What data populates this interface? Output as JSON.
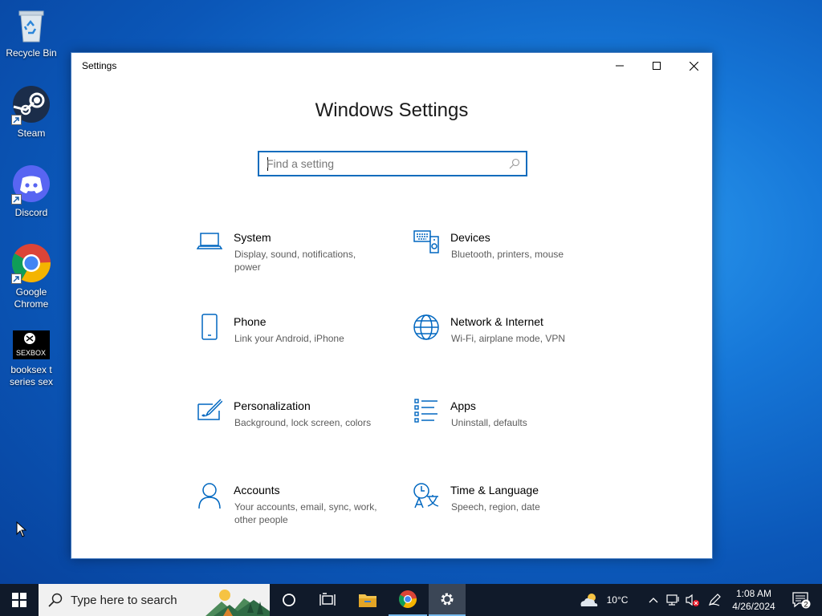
{
  "desktop": {
    "icons": [
      {
        "label": "Recycle Bin"
      },
      {
        "label": "Steam"
      },
      {
        "label": "Discord"
      },
      {
        "label": "Google Chrome"
      },
      {
        "label": "booksex t series sex",
        "thumb_text": "SEXBOX"
      }
    ]
  },
  "window": {
    "title": "Settings",
    "heading": "Windows Settings",
    "search": {
      "placeholder": "Find a setting",
      "value": ""
    },
    "tiles": [
      {
        "name": "System",
        "desc": "Display, sound, notifications, power",
        "icon": "laptop-icon"
      },
      {
        "name": "Devices",
        "desc": "Bluetooth, printers, mouse",
        "icon": "keyboard-speaker-icon"
      },
      {
        "name": "Phone",
        "desc": "Link your Android, iPhone",
        "icon": "phone-icon"
      },
      {
        "name": "Network & Internet",
        "desc": "Wi-Fi, airplane mode, VPN",
        "icon": "globe-icon"
      },
      {
        "name": "Personalization",
        "desc": "Background, lock screen, colors",
        "icon": "paint-icon"
      },
      {
        "name": "Apps",
        "desc": "Uninstall, defaults",
        "icon": "apps-list-icon"
      },
      {
        "name": "Accounts",
        "desc": "Your accounts, email, sync, work, other people",
        "icon": "person-icon"
      },
      {
        "name": "Time & Language",
        "desc": "Speech, region, date",
        "icon": "time-language-icon"
      }
    ]
  },
  "taskbar": {
    "search_text": "Type here to search",
    "weather": "10°C",
    "time": "1:08 AM",
    "date": "4/26/2024",
    "notifications": "2"
  },
  "colors": {
    "accent": "#0067c0",
    "taskbar": "#101a2a"
  }
}
